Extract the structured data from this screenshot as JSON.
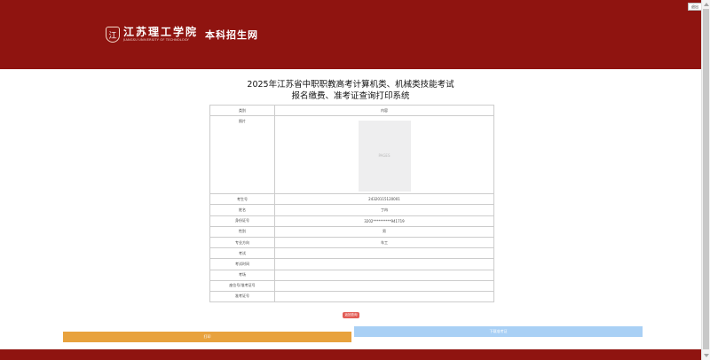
{
  "header": {
    "logo_cn": "江苏理工学院",
    "logo_en": "JIANGSU UNIVERSITY OF TECHNOLOGY",
    "site_name": "本科招生网",
    "corner_button": "退出",
    "colors": {
      "brand": "#8f1410"
    }
  },
  "page": {
    "title_line1": "2025年江苏省中职职教高考计算机类、机械类技能考试",
    "title_line2": "报名缴费、准考证查询打印系统"
  },
  "table": {
    "header": [
      "类别",
      "内容"
    ],
    "photo_label": "照片",
    "photo_placeholder": "PAGES",
    "rows": [
      [
        "考生号",
        "24320115120001"
      ],
      [
        "姓名",
        "丁冉"
      ],
      [
        "身份证号",
        "3202**********941719"
      ],
      [
        "性别",
        "男"
      ],
      [
        "专业方向",
        "车工"
      ],
      [
        "考试",
        ""
      ],
      [
        "考试时间",
        ""
      ],
      [
        "考场",
        ""
      ],
      [
        "座位号/准考证号",
        ""
      ],
      [
        "准考证号",
        ""
      ]
    ]
  },
  "buttons": {
    "red": "返回查询",
    "print": "打印",
    "download": "下载准考证",
    "colors": {
      "print": "#e8a23d",
      "download": "#a9d0f5",
      "red": "#e25c55"
    }
  }
}
